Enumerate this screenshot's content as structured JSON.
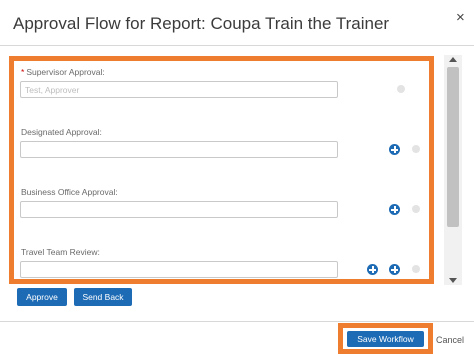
{
  "dialog": {
    "title": "Approval Flow for Report: Coupa Train the Trainer",
    "close_label": "×"
  },
  "fields": [
    {
      "label": "Supervisor Approval:",
      "required": "*",
      "value": "Test, Approver"
    },
    {
      "label": "Designated Approval:",
      "value": ""
    },
    {
      "label": "Business Office Approval:",
      "value": ""
    },
    {
      "label": "Travel Team Review:",
      "value": ""
    }
  ],
  "actions": {
    "approve_label": "Approve",
    "send_back_label": "Send Back"
  },
  "footer": {
    "save_label": "Save Workflow",
    "cancel_label": "Cancel"
  },
  "icons": {
    "add": "plus-circle-icon",
    "close": "close-icon",
    "scroll_up": "chevron-up-icon",
    "scroll_down": "chevron-down-icon"
  },
  "colors": {
    "highlight": "#ee7d2f",
    "primary_button": "#1d6bb5"
  }
}
